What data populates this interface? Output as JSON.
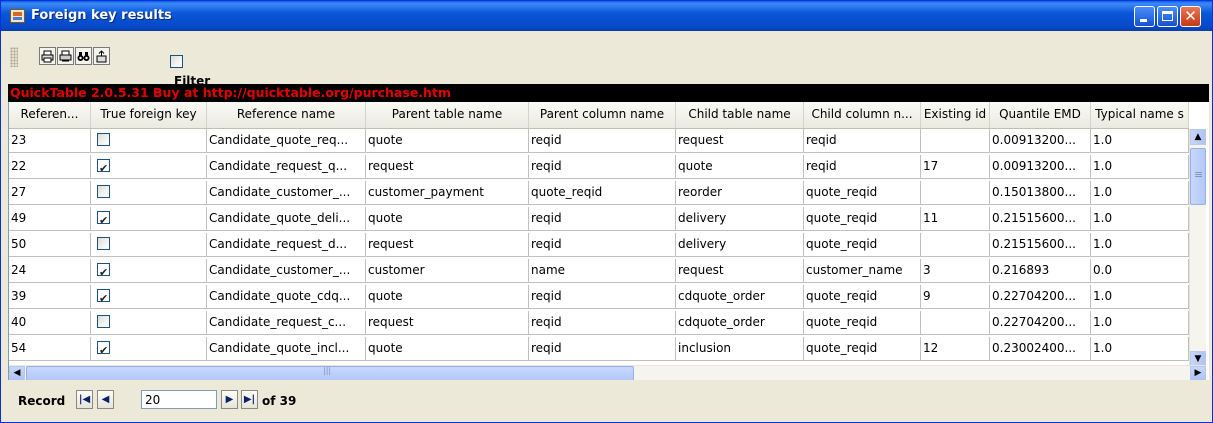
{
  "window": {
    "title": "Foreign key results",
    "title_icon": "java-app-icon",
    "controls": {
      "minimize": "minimize-icon",
      "maximize": "maximize-icon",
      "close": "✕"
    }
  },
  "toolbar": {
    "icons": [
      "print-icon",
      "print-preview-icon",
      "find-icon",
      "export-icon"
    ],
    "filter_label": "Filter results",
    "filter_checked": false
  },
  "banner": {
    "text": "QuickTable 2.0.5.31 Buy at http://quicktable.org/purchase.htm",
    "text_color": "#e40000",
    "background": "#000000"
  },
  "table": {
    "columns": [
      "Referen...",
      "True foreign key",
      "Reference name",
      "Parent table name",
      "Parent column name",
      "Child table name",
      "Child column n...",
      "Existing id",
      "Quantile EMD",
      "Typical name s"
    ],
    "rows": [
      {
        "ref": "23",
        "fk": false,
        "refname": "Candidate_quote_req...",
        "ptable": "quote",
        "pcol": "reqid",
        "ctable": "request",
        "ccol": "reqid",
        "existing": "",
        "emd": "0.00913200...",
        "typ": "1.0"
      },
      {
        "ref": "22",
        "fk": true,
        "refname": "Candidate_request_q...",
        "ptable": "request",
        "pcol": "reqid",
        "ctable": "quote",
        "ccol": "reqid",
        "existing": "17",
        "emd": "0.00913200...",
        "typ": "1.0"
      },
      {
        "ref": "27",
        "fk": false,
        "refname": "Candidate_customer_...",
        "ptable": "customer_payment",
        "pcol": "quote_reqid",
        "ctable": "reorder",
        "ccol": "quote_reqid",
        "existing": "",
        "emd": "0.15013800...",
        "typ": "1.0"
      },
      {
        "ref": "49",
        "fk": true,
        "refname": "Candidate_quote_deli...",
        "ptable": "quote",
        "pcol": "reqid",
        "ctable": "delivery",
        "ccol": "quote_reqid",
        "existing": "11",
        "emd": "0.21515600...",
        "typ": "1.0"
      },
      {
        "ref": "50",
        "fk": false,
        "refname": "Candidate_request_d...",
        "ptable": "request",
        "pcol": "reqid",
        "ctable": "delivery",
        "ccol": "quote_reqid",
        "existing": "",
        "emd": "0.21515600...",
        "typ": "1.0"
      },
      {
        "ref": "24",
        "fk": true,
        "refname": "Candidate_customer_...",
        "ptable": "customer",
        "pcol": "name",
        "ctable": "request",
        "ccol": "customer_name",
        "existing": "3",
        "emd": "0.216893",
        "typ": "0.0"
      },
      {
        "ref": "39",
        "fk": true,
        "refname": "Candidate_quote_cdq...",
        "ptable": "quote",
        "pcol": "reqid",
        "ctable": "cdquote_order",
        "ccol": "quote_reqid",
        "existing": "9",
        "emd": "0.22704200...",
        "typ": "1.0"
      },
      {
        "ref": "40",
        "fk": false,
        "refname": "Candidate_request_c...",
        "ptable": "request",
        "pcol": "reqid",
        "ctable": "cdquote_order",
        "ccol": "quote_reqid",
        "existing": "",
        "emd": "0.22704200...",
        "typ": "1.0"
      },
      {
        "ref": "54",
        "fk": true,
        "refname": "Candidate_quote_incl...",
        "ptable": "quote",
        "pcol": "reqid",
        "ctable": "inclusion",
        "ccol": "quote_reqid",
        "existing": "12",
        "emd": "0.23002400...",
        "typ": "1.0"
      }
    ]
  },
  "navigator": {
    "label": "Record",
    "current": "20",
    "total_text": "of 39"
  }
}
